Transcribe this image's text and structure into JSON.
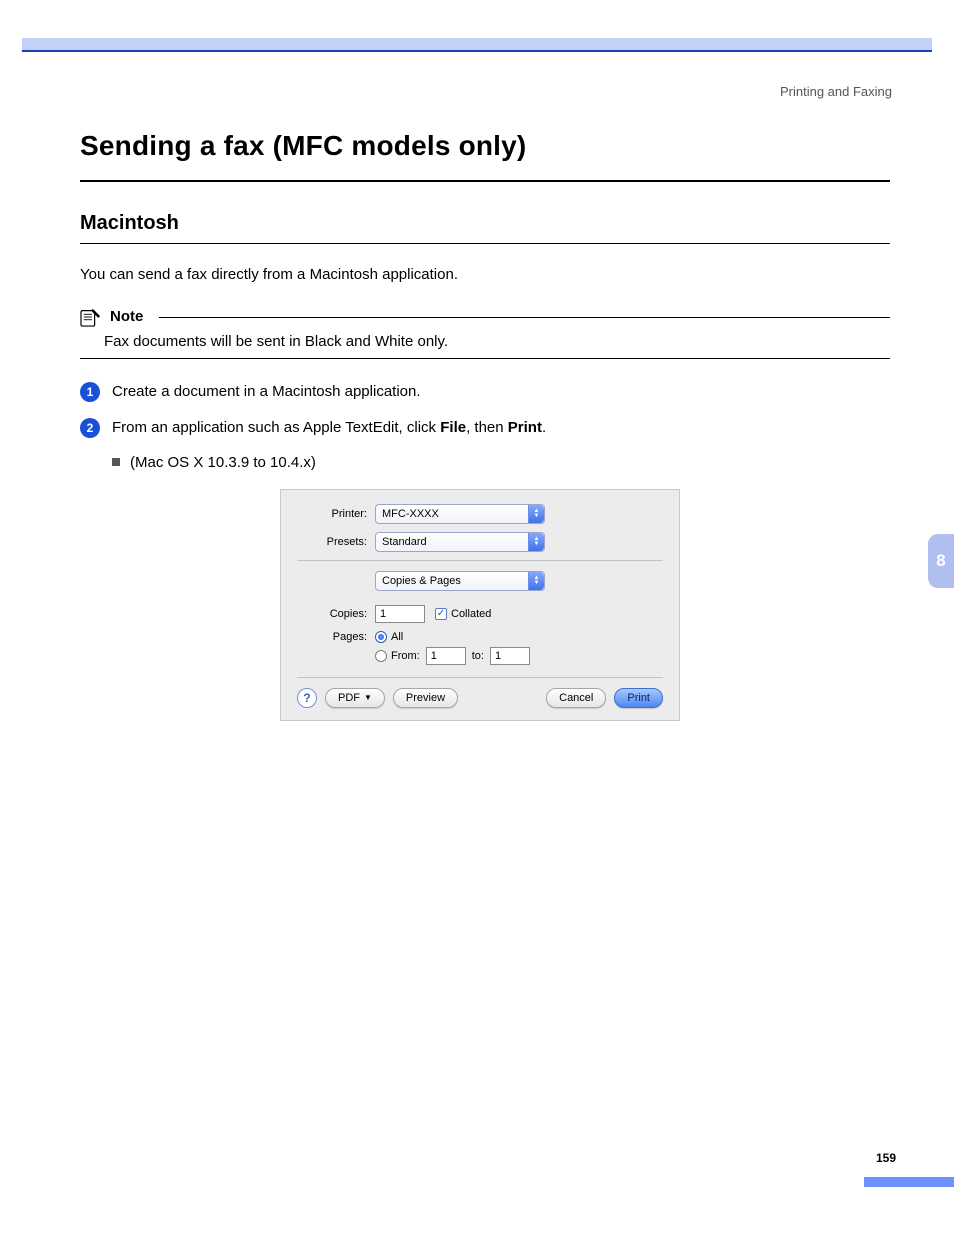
{
  "header": {
    "section": "Printing and Faxing"
  },
  "title": "Sending a fax (MFC models only)",
  "subtitle": "Macintosh",
  "intro": "You can send a fax directly from a Macintosh application.",
  "note": {
    "label": "Note",
    "body": "Fax documents will be sent in Black and White only."
  },
  "steps": {
    "s1": {
      "num": "1",
      "text": "Create a document in a Macintosh application."
    },
    "s2": {
      "num": "2",
      "prefix": "From an application such as Apple TextEdit, click ",
      "bold1": "File",
      "mid": ", then ",
      "bold2": "Print",
      "suffix": "."
    }
  },
  "bullet": "(Mac OS X 10.3.9 to 10.4.x)",
  "dialog": {
    "labels": {
      "printer": "Printer:",
      "presets": "Presets:",
      "copies": "Copies:",
      "pages": "Pages:",
      "from": "From:",
      "to": "to:"
    },
    "values": {
      "printer": "MFC-XXXX",
      "presets": "Standard",
      "panel": "Copies & Pages",
      "copies": "1",
      "collated": "Collated",
      "pages_all": "All",
      "from": "1",
      "to": "1"
    },
    "buttons": {
      "pdf": "PDF",
      "preview": "Preview",
      "cancel": "Cancel",
      "print": "Print",
      "help": "?"
    }
  },
  "sideTab": "8",
  "pageNumber": "159"
}
